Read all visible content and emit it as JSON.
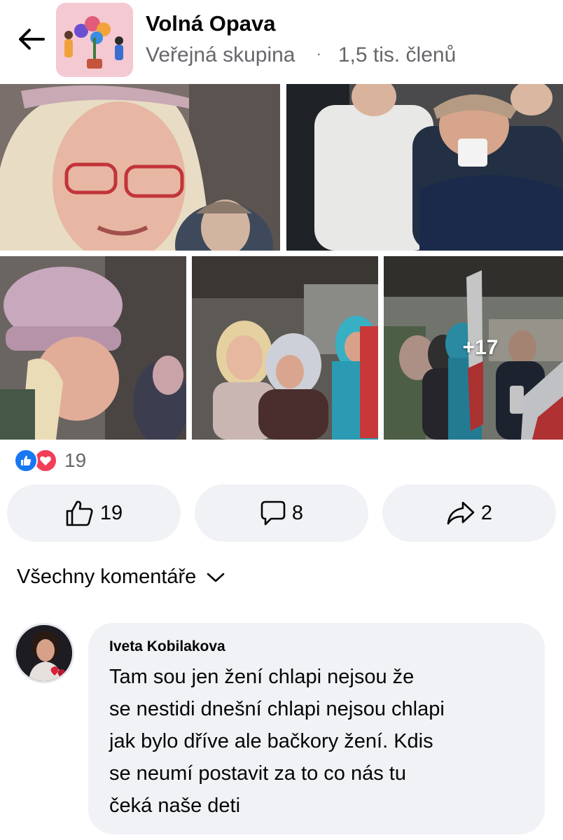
{
  "header": {
    "group_name": "Volná Opava",
    "group_type": "Veřejná skupina",
    "separator": "·",
    "members": "1,5 tis. členů"
  },
  "photos": {
    "more_count": "+17"
  },
  "reactions": {
    "count": "19",
    "types": [
      "like-icon",
      "love-icon"
    ]
  },
  "actions": {
    "like_count": "19",
    "comment_count": "8",
    "share_count": "2"
  },
  "comments_section": {
    "filter_label": "Všechny komentáře"
  },
  "comment": {
    "author": "Iveta Kobilakova",
    "text": "Tam sou  jen žení  chlapi nejsou  že\nse nestidi dnešní chlapi nejsou chlapi\njak bylo dříve ale bačkory žení. Kdis\nse neumí postavit za to co nás tu\nčeká   naše deti"
  },
  "colors": {
    "like_blue": "#1877f2",
    "love_red": "#f33e58",
    "pill_bg": "#f0f2f5",
    "meta_gray": "#65676b"
  }
}
